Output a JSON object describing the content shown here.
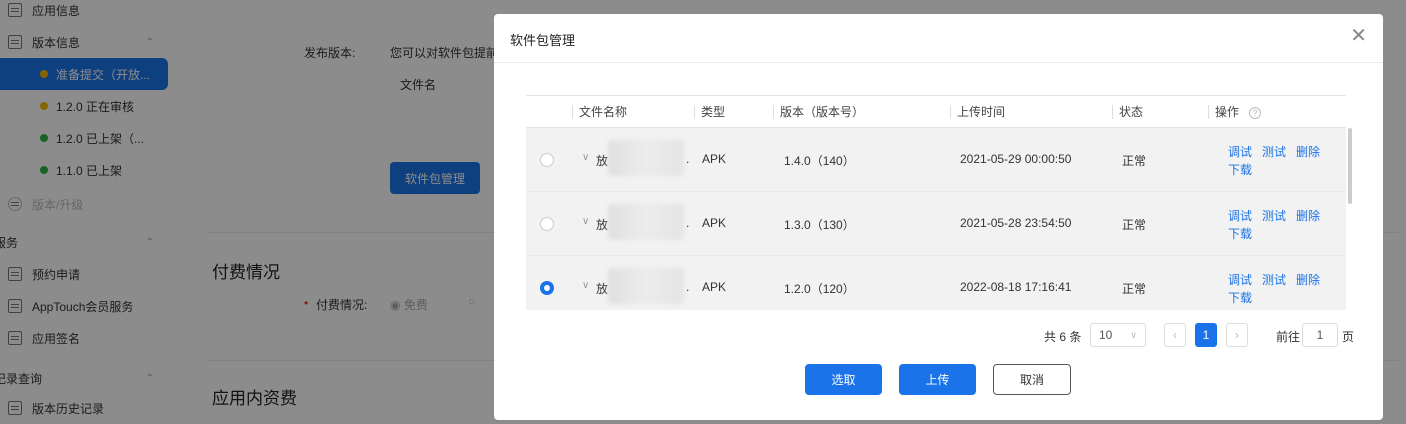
{
  "sidebar": {
    "items": [
      {
        "label": "应用信息"
      },
      {
        "label": "版本信息"
      }
    ],
    "versions": [
      {
        "label": "准备提交（开放...",
        "color": "#f5b800",
        "active": true
      },
      {
        "label": "1.2.0 正在审核",
        "color": "#f5b800"
      },
      {
        "label": "1.2.0 已上架（...",
        "color": "#2db34a"
      },
      {
        "label": "1.1.0 已上架",
        "color": "#2db34a"
      }
    ],
    "upgrade_label": "版本/升级",
    "groups": [
      {
        "label": "服务"
      },
      {
        "label": "记录查询"
      }
    ],
    "service_items": [
      {
        "label": "预约申请"
      },
      {
        "label": "AppTouch会员服务"
      },
      {
        "label": "应用签名"
      }
    ],
    "record_items": [
      {
        "label": "版本历史记录"
      }
    ]
  },
  "page": {
    "release_label": "发布版本:",
    "release_hint": "您可以对软件包提前",
    "file_col": "文件名",
    "pkg_button": "软件包管理",
    "payment_heading": "付费情况",
    "payment_label": "付费情况:",
    "payment_required_mark": "•",
    "payment_free": "免费",
    "iap_heading": "应用内资费"
  },
  "modal": {
    "title": "软件包管理",
    "columns": [
      "文件名称",
      "类型",
      "版本（版本号）",
      "上传时间",
      "状态",
      "操作"
    ],
    "rows": [
      {
        "name": "放",
        "suffix": ".",
        "type": "APK",
        "version": "1.4.0（140）",
        "time": "2021-05-29 00:00:50",
        "status": "正常",
        "selected": false
      },
      {
        "name": "放",
        "suffix": ".",
        "type": "APK",
        "version": "1.3.0（130）",
        "time": "2021-05-28 23:54:50",
        "status": "正常",
        "selected": false
      },
      {
        "name": "放",
        "suffix": ".",
        "type": "APK",
        "version": "1.2.0（120）",
        "time": "2022-08-18 17:16:41",
        "status": "正常",
        "selected": true
      }
    ],
    "actions": {
      "debug": "调试",
      "test": "测试",
      "delete": "删除",
      "download": "下载"
    },
    "pager": {
      "total": "共 6 条",
      "page_size": "10",
      "current": "1",
      "goto_label": "前往",
      "goto_value": "1",
      "page_unit": "页"
    },
    "buttons": {
      "select": "选取",
      "upload": "上传",
      "cancel": "取消"
    }
  },
  "colors": {
    "accent": "#1a73e8"
  }
}
